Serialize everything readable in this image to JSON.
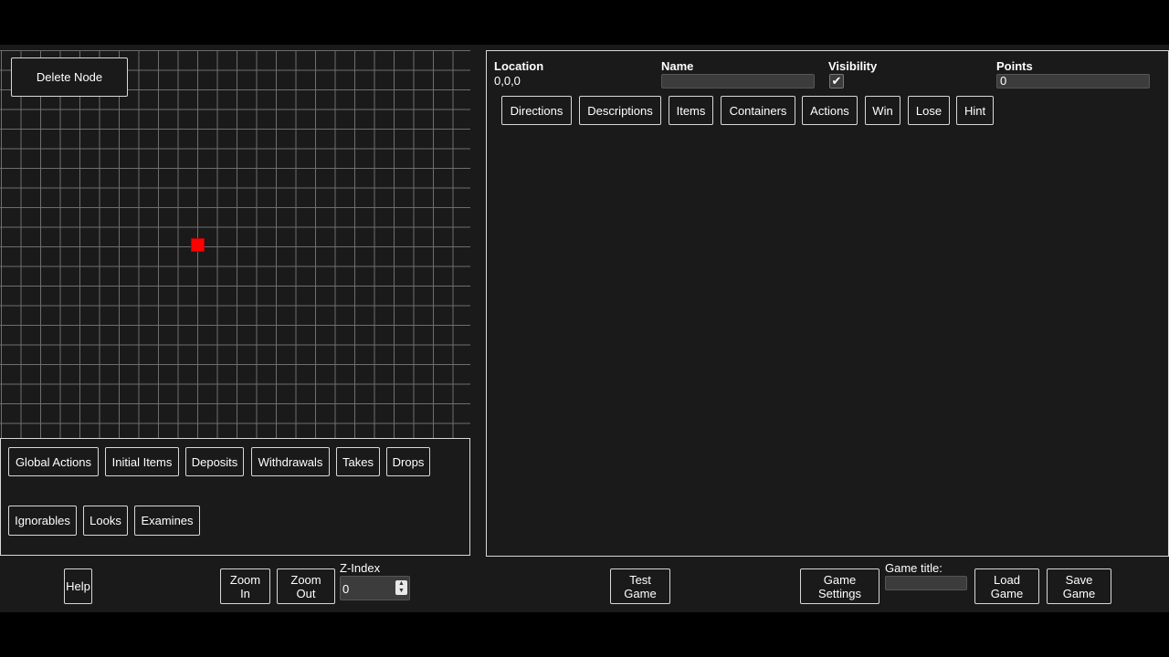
{
  "map": {
    "delete_node": "Delete Node"
  },
  "lists": {
    "row1": [
      "Global Actions",
      "Initial Items",
      "Deposits",
      "Withdrawals",
      "Takes",
      "Drops"
    ],
    "row2": [
      "Ignorables",
      "Looks",
      "Examines"
    ]
  },
  "editor": {
    "location_label": "Location",
    "location_value": "0,0,0",
    "name_label": "Name",
    "name_value": "",
    "visibility_label": "Visibility",
    "visibility_checked": true,
    "points_label": "Points",
    "points_value": "0",
    "tabs": [
      "Directions",
      "Descriptions",
      "Items",
      "Containers",
      "Actions",
      "Win",
      "Lose",
      "Hint"
    ]
  },
  "bottom": {
    "help": "Help",
    "zoom_in": "Zoom\nIn",
    "zoom_out": "Zoom\nOut",
    "zindex_label": "Z-Index",
    "zindex_value": "0",
    "test_game": "Test\nGame",
    "game_settings": "Game\nSettings",
    "game_title_label": "Game title:",
    "game_title_value": "",
    "load_game": "Load\nGame",
    "save_game": "Save\nGame"
  },
  "icons": {
    "check": "checkmark-icon",
    "spinner": "spinner-arrows-icon"
  },
  "colors": {
    "background": "#1a1a1a",
    "node": "#ff0000",
    "grid_line": "#6e6e6e"
  }
}
